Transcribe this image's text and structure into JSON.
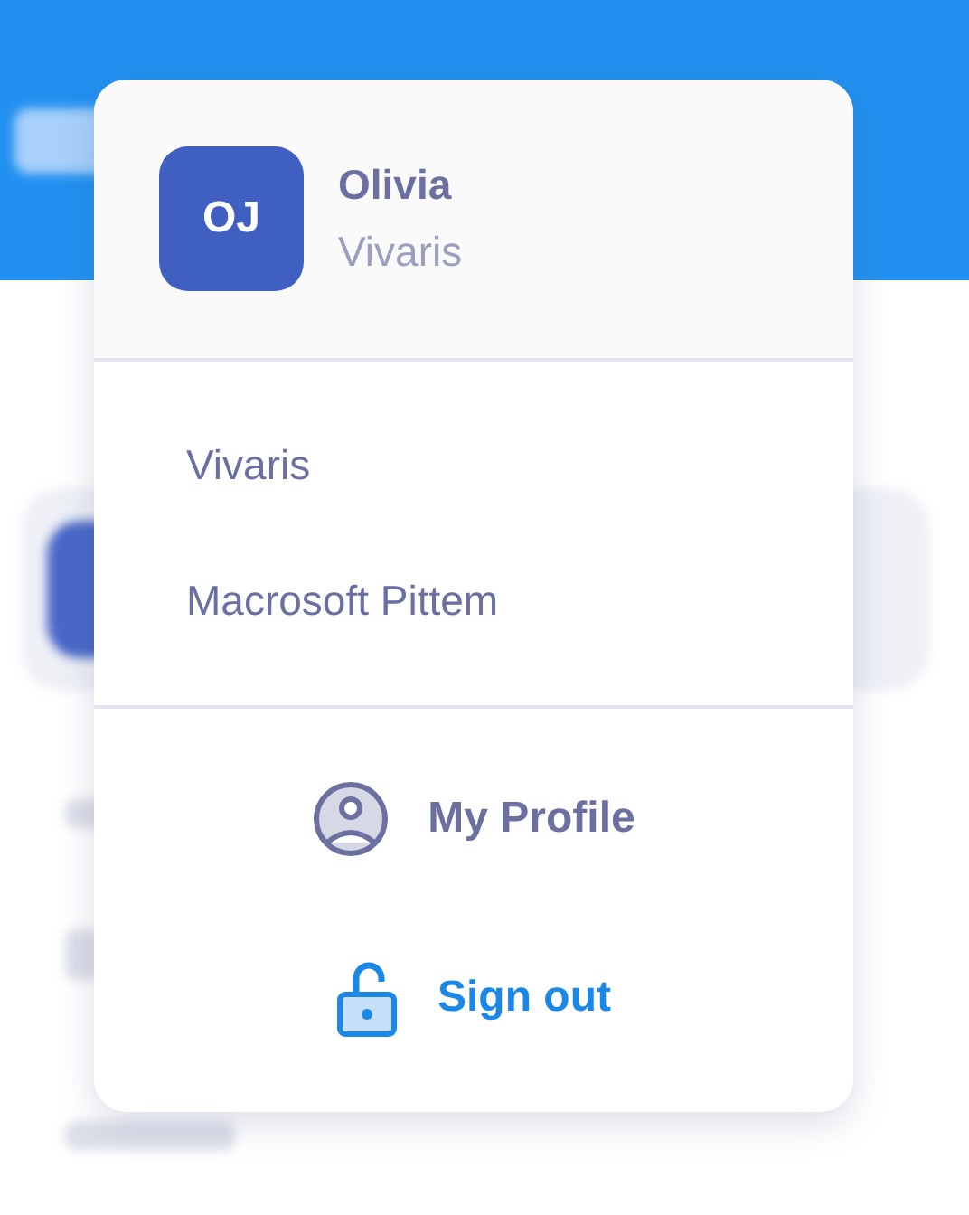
{
  "account_menu": {
    "user": {
      "initials": "OJ",
      "name": "Olivia",
      "organization": "Vivaris"
    },
    "organizations": [
      {
        "label": "Vivaris"
      },
      {
        "label": "Macrosoft Pittem"
      }
    ],
    "actions": [
      {
        "kind": "profile",
        "label": "My Profile"
      },
      {
        "kind": "signout",
        "label": "Sign out"
      }
    ]
  }
}
